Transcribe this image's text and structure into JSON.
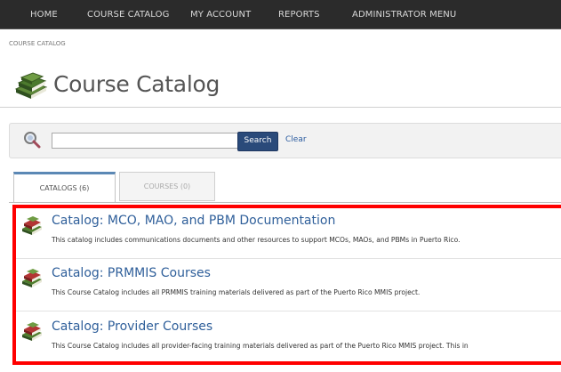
{
  "nav": {
    "items": [
      {
        "label": "HOME"
      },
      {
        "label": "COURSE CATALOG"
      },
      {
        "label": "MY ACCOUNT"
      },
      {
        "label": "REPORTS"
      },
      {
        "label": "ADMINISTRATOR MENU"
      }
    ]
  },
  "breadcrumb": "COURSE CATALOG",
  "page_title": "Course Catalog",
  "search": {
    "value": "",
    "button_label": "Search",
    "clear_label": "Clear"
  },
  "tabs": [
    {
      "label": "CATALOGS (6)"
    },
    {
      "label": "COURSES (0)"
    }
  ],
  "catalogs": [
    {
      "name": "Catalog: MCO, MAO, and PBM Documentation",
      "description": "This catalog includes communications documents and other resources to support MCOs, MAOs, and PBMs in Puerto Rico."
    },
    {
      "name": "Catalog: PRMMIS Courses",
      "description": "This Course Catalog includes all PRMMIS training materials delivered as part of the Puerto Rico MMIS project."
    },
    {
      "name": "Catalog: Provider Courses",
      "description": "This Course Catalog includes all provider-facing training materials delivered as part of the Puerto Rico MMIS project. This in"
    }
  ],
  "icons": {
    "book_stack": "book-stack-icon",
    "search": "magnifier-icon"
  },
  "colors": {
    "nav_bg": "#2b2b2b",
    "link": "#2f5f9a",
    "search_button": "#2a4a7a",
    "highlight": "#ff0000"
  }
}
